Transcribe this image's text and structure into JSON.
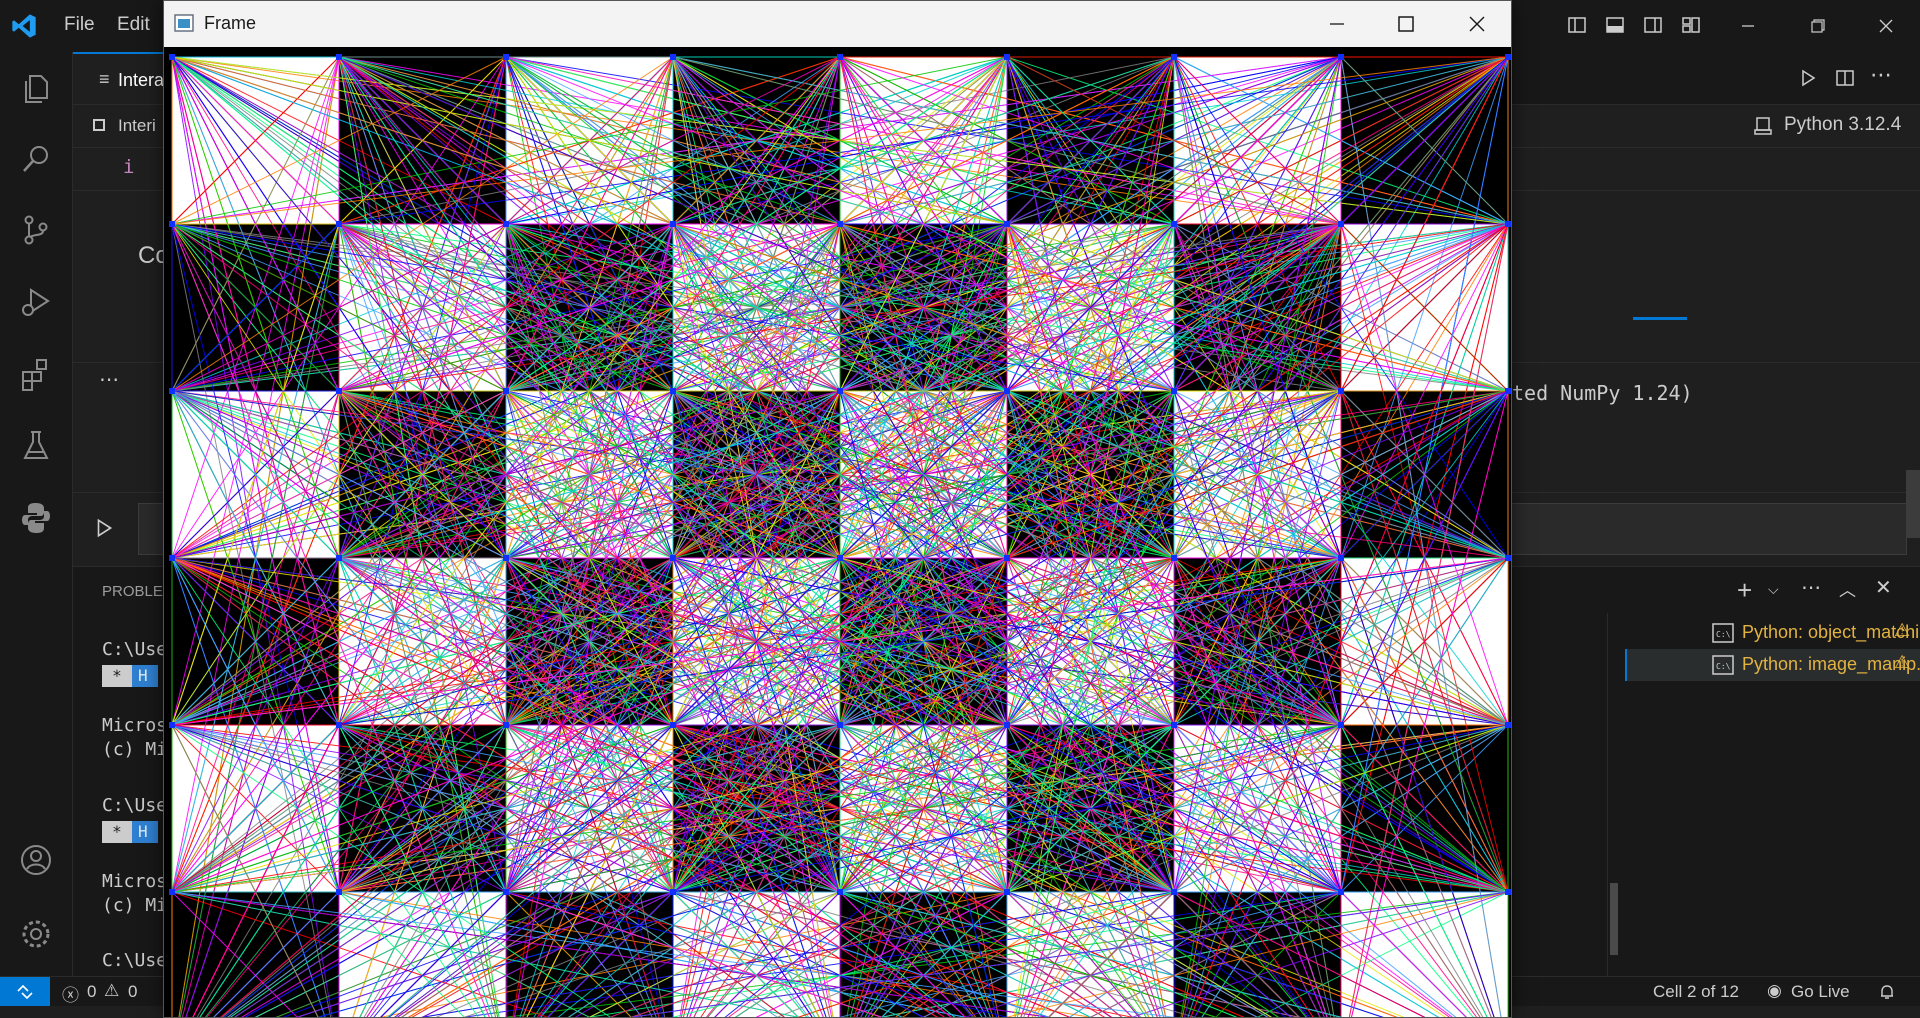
{
  "menubar": {
    "file": "File",
    "edit": "Edit"
  },
  "editor": {
    "tab_label": "Intera",
    "breadcrumb": "Interi",
    "code_fragment": "i",
    "cell_fragment": "Co",
    "output_line": "ted NumPy 1.24)",
    "kernel": "Python 3.12.4"
  },
  "panel": {
    "tab_label": "PROBLEI",
    "lines": [
      "C:\\Use",
      "Micros",
      "(c) Mi",
      "C:\\Use",
      "Micros",
      "(c) Mi",
      "C:\\Use"
    ],
    "badge_star": "*",
    "badge_text": "H",
    "terminals": [
      "Python: object_matchi...",
      "Python: image_manip..."
    ]
  },
  "statusbar": {
    "errors": "0",
    "warnings": "0",
    "cell": "Cell 2 of 12",
    "go_live": "Go Live"
  },
  "frame_window": {
    "title": "Frame"
  },
  "colors": {
    "accent": "#0078d4",
    "background": "#1f1f1f",
    "warning": "#e3b341"
  },
  "icons": [
    "vscode-logo-icon",
    "explorer-icon",
    "search-icon",
    "source-control-icon",
    "run-debug-icon",
    "extensions-icon",
    "testing-icon",
    "python-icon",
    "account-icon",
    "settings-icon"
  ]
}
